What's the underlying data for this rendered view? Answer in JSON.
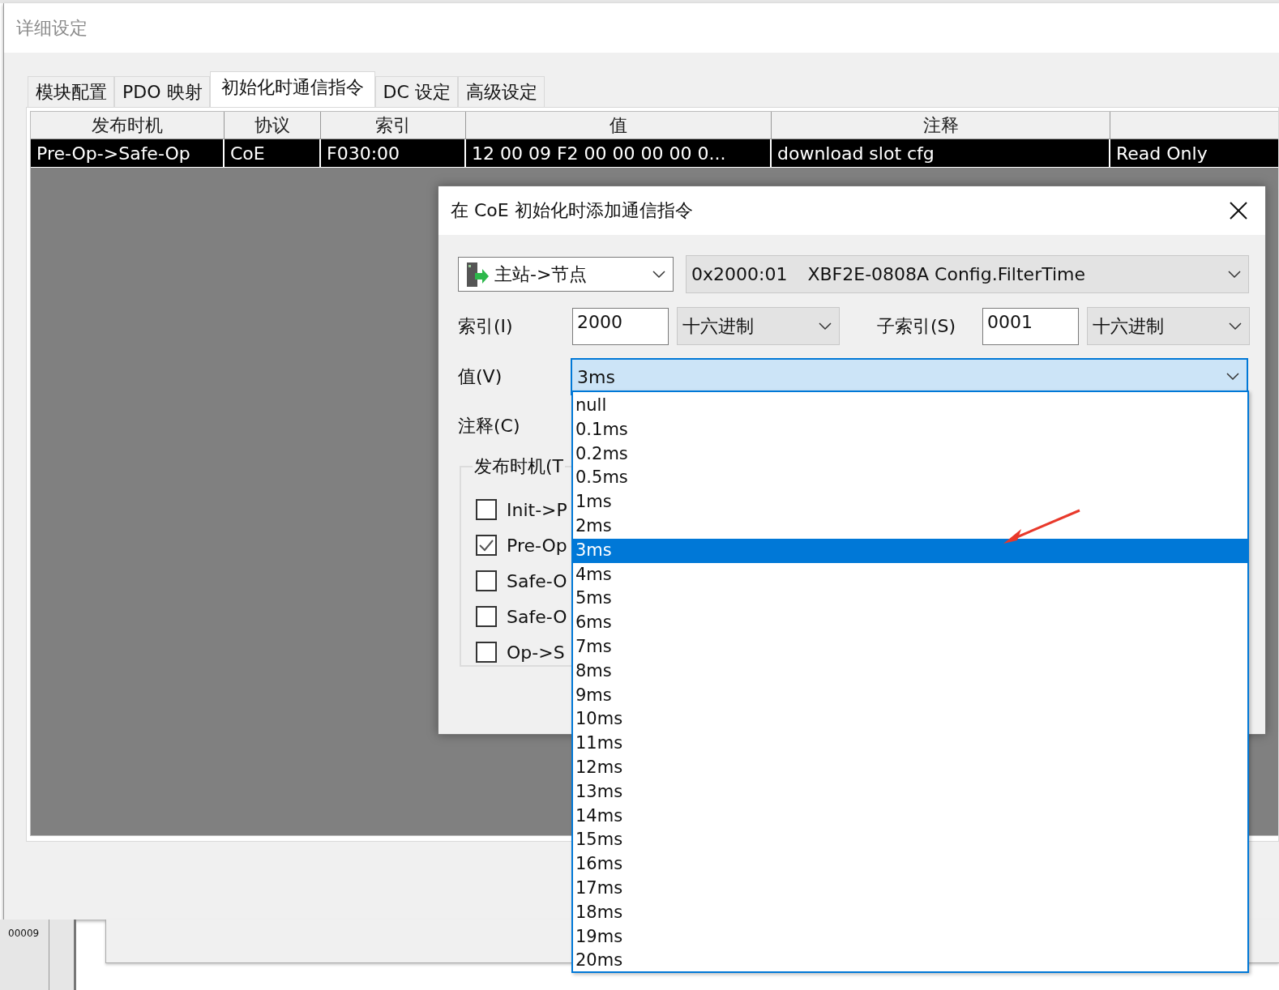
{
  "window": {
    "title": "详细设定"
  },
  "tabs": [
    {
      "label": "模块配置",
      "selected": false
    },
    {
      "label": "PDO 映射",
      "selected": false
    },
    {
      "label": "初始化时通信指令",
      "selected": true
    },
    {
      "label": "DC 设定",
      "selected": false
    },
    {
      "label": "高级设定",
      "selected": false
    }
  ],
  "table": {
    "columns": [
      "发布时机",
      "协议",
      "索引",
      "值",
      "注释"
    ],
    "rows": [
      {
        "selected": true,
        "cells": [
          "Pre-Op->Safe-Op",
          "CoE",
          "F030:00",
          "12 00 09 F2 00 00 00 00 0...",
          "download slot cfg",
          "Read Only"
        ]
      }
    ]
  },
  "background": {
    "row_number": "00009"
  },
  "dialog": {
    "title": "在 CoE 初始化时添加通信指令",
    "direction": {
      "value": "主站->节点"
    },
    "object": {
      "address": "0x2000:01",
      "name": "XBF2E-0808A Config.FilterTime"
    },
    "index": {
      "label": "索引(I)",
      "value": "2000",
      "format": "十六进制"
    },
    "subindex": {
      "label": "子索引(S)",
      "value": "0001",
      "format": "十六进制"
    },
    "value": {
      "label": "值(V)",
      "value": "3ms",
      "focused": true
    },
    "comment": {
      "label": "注释(C)"
    },
    "timing": {
      "label": "发布时机(T",
      "options": [
        {
          "label": "Init->P",
          "checked": false
        },
        {
          "label": "Pre-Op",
          "checked": true
        },
        {
          "label": "Safe-O",
          "checked": false
        },
        {
          "label": "Safe-O",
          "checked": false
        },
        {
          "label": "Op->S",
          "checked": false
        }
      ]
    }
  },
  "dropdown": {
    "options": [
      {
        "label": "null",
        "selected": false
      },
      {
        "label": "0.1ms",
        "selected": false
      },
      {
        "label": "0.2ms",
        "selected": false
      },
      {
        "label": "0.5ms",
        "selected": false
      },
      {
        "label": "1ms",
        "selected": false
      },
      {
        "label": "2ms",
        "selected": false
      },
      {
        "label": "3ms",
        "selected": true
      },
      {
        "label": "4ms",
        "selected": false
      },
      {
        "label": "5ms",
        "selected": false
      },
      {
        "label": "6ms",
        "selected": false
      },
      {
        "label": "7ms",
        "selected": false
      },
      {
        "label": "8ms",
        "selected": false
      },
      {
        "label": "9ms",
        "selected": false
      },
      {
        "label": "10ms",
        "selected": false
      },
      {
        "label": "11ms",
        "selected": false
      },
      {
        "label": "12ms",
        "selected": false
      },
      {
        "label": "13ms",
        "selected": false
      },
      {
        "label": "14ms",
        "selected": false
      },
      {
        "label": "15ms",
        "selected": false
      },
      {
        "label": "16ms",
        "selected": false
      },
      {
        "label": "17ms",
        "selected": false
      },
      {
        "label": "18ms",
        "selected": false
      },
      {
        "label": "19ms",
        "selected": false
      },
      {
        "label": "20ms",
        "selected": false
      }
    ]
  }
}
